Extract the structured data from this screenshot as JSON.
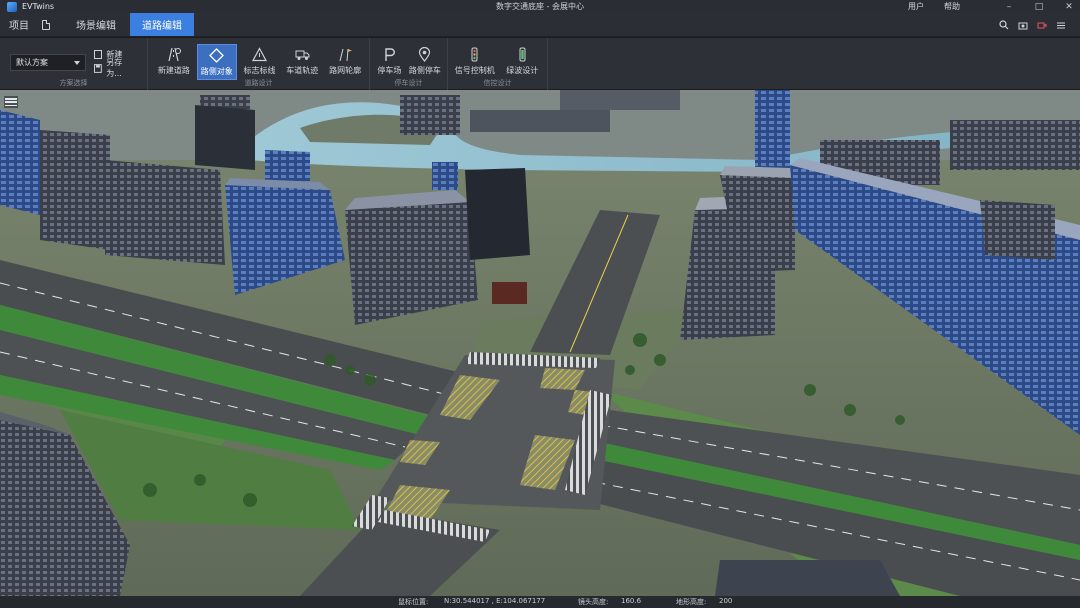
{
  "app": {
    "name": "EVTwins",
    "window_title": "数字交通底座 - 会展中心"
  },
  "title_links": {
    "user": "用户",
    "help": "帮助"
  },
  "menu": {
    "project": "项目",
    "tabs": [
      "场景编辑",
      "道路编辑"
    ],
    "active_tab": "道路编辑"
  },
  "ribbon": {
    "scheme": {
      "selected": "默认方案",
      "new": "新建",
      "save_as": "另存为...",
      "label": "方案选择"
    },
    "road_design": {
      "label": "道路设计",
      "buttons": [
        "新建道路",
        "路侧对象",
        "标志标线",
        "车道轨迹",
        "路网轮廓"
      ],
      "active": "路侧对象"
    },
    "parking_design": {
      "label": "停车设计",
      "buttons": [
        "停车场",
        "路侧停车"
      ]
    },
    "signal_design": {
      "label": "信控设计",
      "buttons": [
        "信号控制机",
        "绿波设计"
      ]
    }
  },
  "status": {
    "mouse_label": "鼠标位置:",
    "mouse_value": "N:30.544017 , E:104.067177",
    "camera_label": "镜头高度:",
    "camera_value": "160.6",
    "terrain_label": "地形高度:",
    "terrain_value": "200"
  },
  "colors": {
    "accent": "#3b7fe0",
    "active_tool": "#3d6fc1",
    "chrome": "#2b2e34"
  }
}
